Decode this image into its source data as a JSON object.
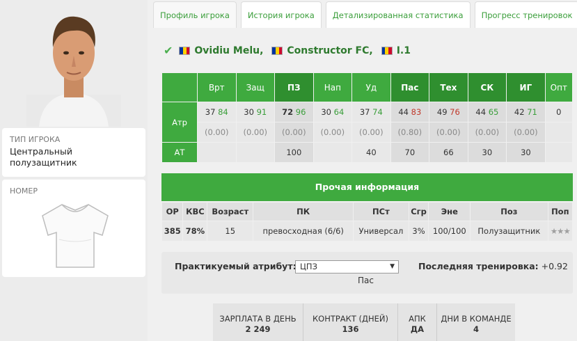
{
  "tabs": [
    {
      "label": "Профиль игрока",
      "active": true
    },
    {
      "label": "История игрока",
      "active": false
    },
    {
      "label": "Детализированная статистика",
      "active": false
    },
    {
      "label": "Прогресс тренировок",
      "active": false
    }
  ],
  "player": {
    "name": "Ovidiu Melu,",
    "club": "Constructor FC,",
    "league": "I.1",
    "flag_colors": [
      "#0033a0",
      "#ffd200",
      "#cc092f"
    ]
  },
  "type_card": {
    "label": "ТИП ИГРОКА",
    "value": "Центральный полузащитник"
  },
  "number_card": {
    "label": "НОМЕР"
  },
  "attributes": {
    "columns": [
      "Врт",
      "Защ",
      "ПЗ",
      "Нап",
      "Уд",
      "Пас",
      "Тех",
      "СК",
      "ИГ",
      "Опт"
    ],
    "dark_columns": [
      2,
      5,
      6,
      7,
      8
    ],
    "row_labels": {
      "atr": "Атр",
      "at": "АТ"
    },
    "values": [
      {
        "base": "37",
        "pot": "84",
        "color": "g"
      },
      {
        "base": "30",
        "pot": "91",
        "color": "g"
      },
      {
        "base": "72",
        "pot": "96",
        "color": "g",
        "bold": true
      },
      {
        "base": "30",
        "pot": "64",
        "color": "g"
      },
      {
        "base": "37",
        "pot": "74",
        "color": "g"
      },
      {
        "base": "44",
        "pot": "83",
        "color": "r"
      },
      {
        "base": "49",
        "pot": "76",
        "color": "r"
      },
      {
        "base": "44",
        "pot": "65",
        "color": "g"
      },
      {
        "base": "42",
        "pot": "71",
        "color": "g"
      },
      {
        "base": "0",
        "pot": "",
        "color": "g"
      }
    ],
    "deltas": [
      "(0.00)",
      "(0.00)",
      "(0.00)",
      "(0.00)",
      "(0.00)",
      "(0.80)",
      "(0.00)",
      "(0.00)",
      "(0.00)",
      ""
    ],
    "at": [
      "",
      "",
      "100",
      "",
      "40",
      "70",
      "66",
      "30",
      "30",
      ""
    ]
  },
  "info": {
    "title": "Прочая информация",
    "headers": [
      "ОР",
      "КВС",
      "Возраст",
      "ПК",
      "ПСт",
      "Сгр",
      "Эне",
      "Поз",
      "Поп"
    ],
    "values": [
      "385",
      "78%",
      "15",
      "превосходная (6/6)",
      "Универсал",
      "3%",
      "100/100",
      "Полузащитник"
    ],
    "stars_filled": 0,
    "stars_total": 3
  },
  "training": {
    "label": "Практикуемый атрибут:",
    "selected": "ЦПЗ",
    "sub": "Пас",
    "last_label": "Последняя тренировка:",
    "last_value": "+0.92"
  },
  "contract": [
    {
      "label": "ЗАРПЛАТА В ДЕНЬ",
      "value": "2 249"
    },
    {
      "label": "КОНТРАКТ (ДНЕЙ)",
      "value": "136"
    },
    {
      "label": "АПК",
      "value": "ДА"
    },
    {
      "label": "ДНИ В КОМАНДЕ",
      "value": "4"
    }
  ]
}
